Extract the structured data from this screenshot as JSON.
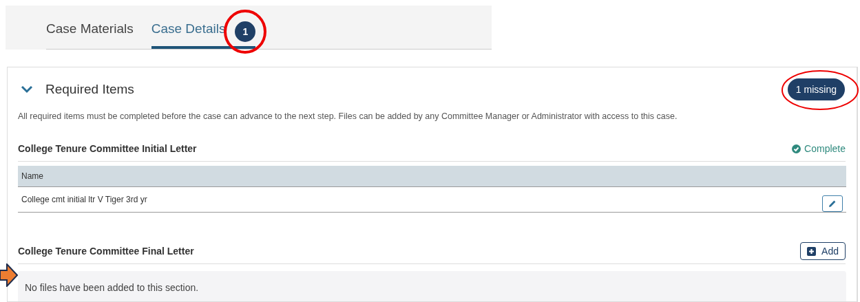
{
  "tabs": [
    {
      "label": "Case Materials",
      "selected": false
    },
    {
      "label": "Case Details",
      "selected": true,
      "badge": "1"
    }
  ],
  "panel": {
    "title": "Required Items",
    "expanded": true,
    "status_badge": "1 missing",
    "description": "All required items must be completed before the case can advance to the next step. Files can be added by any Committee Manager or Administrator with access to this case."
  },
  "sections": [
    {
      "kind": "table",
      "title": "College Tenure Committee Initial Letter",
      "status": "Complete",
      "columns": [
        "Name"
      ],
      "rows": [
        {
          "name": "College cmt initial ltr V Tiger 3rd yr"
        }
      ]
    },
    {
      "kind": "empty",
      "title": "College Tenure Committee Final Letter",
      "action": "Add",
      "empty_message": "No files have been added to this section."
    }
  ]
}
